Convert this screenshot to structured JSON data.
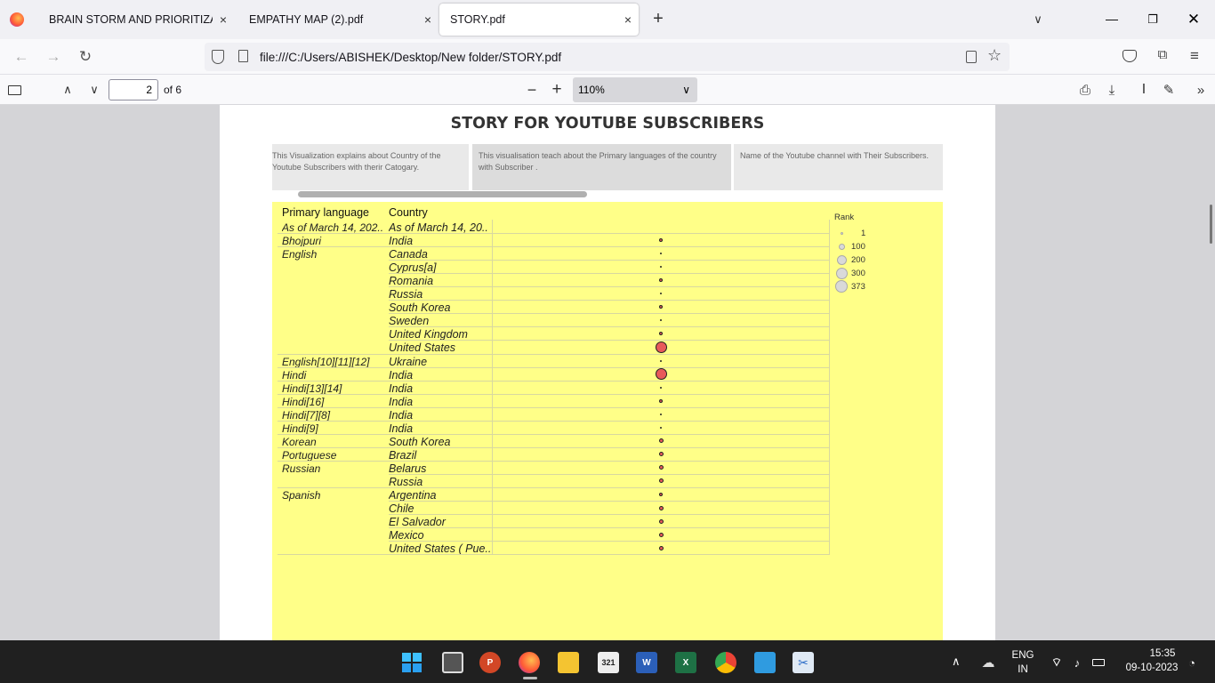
{
  "browser": {
    "tabs": [
      {
        "title": "BRAIN STORM AND PRIORITIZATION",
        "close": "×"
      },
      {
        "title": "EMPATHY MAP (2).pdf",
        "close": "×"
      },
      {
        "title": "STORY.pdf",
        "close": "×"
      }
    ],
    "url": "file:///C:/Users/ABISHEK/Desktop/New folder/STORY.pdf"
  },
  "pdf_toolbar": {
    "page_number": "2",
    "page_total": "of 6",
    "zoom": "110%"
  },
  "document": {
    "title": "STORY FOR YOUTUBE SUBSCRIBERS",
    "story_points": [
      {
        "text": "This Visualization explains about Country of the Youtube Subscribers with therir Catogary."
      },
      {
        "text": "This visualisation teach about the Primary languages of the country with Subscriber ."
      },
      {
        "text": "Name of the Youtube channel with Their Subscribers."
      }
    ],
    "headers": {
      "language": "Primary language",
      "country": "Country"
    },
    "legend": {
      "title": "Rank",
      "items": [
        "1",
        "100",
        "200",
        "300",
        "373"
      ]
    },
    "rows": [
      {
        "language": "As of March 14, 202..",
        "country": "As of March 14, 20..",
        "dot": "none"
      },
      {
        "language": "Bhojpuri",
        "country": "India",
        "dot": "s"
      },
      {
        "language": "English",
        "country": "Canada",
        "dot": "xs"
      },
      {
        "language": "",
        "country": "Cyprus[a]",
        "dot": "xs"
      },
      {
        "language": "",
        "country": "Romania",
        "dot": "s"
      },
      {
        "language": "",
        "country": "Russia",
        "dot": "xs"
      },
      {
        "language": "",
        "country": "South Korea",
        "dot": "s"
      },
      {
        "language": "",
        "country": "Sweden",
        "dot": "xs"
      },
      {
        "language": "",
        "country": "United Kingdom",
        "dot": "s"
      },
      {
        "language": "",
        "country": "United States",
        "dot": "l"
      },
      {
        "language": "English[10][11][12]",
        "country": "Ukraine",
        "dot": "xs"
      },
      {
        "language": "Hindi",
        "country": "India",
        "dot": "l"
      },
      {
        "language": "Hindi[13][14]",
        "country": "India",
        "dot": "xs"
      },
      {
        "language": "Hindi[16]",
        "country": "India",
        "dot": "s"
      },
      {
        "language": "Hindi[7][8]",
        "country": "India",
        "dot": "xs"
      },
      {
        "language": "Hindi[9]",
        "country": "India",
        "dot": "xs"
      },
      {
        "language": "Korean",
        "country": "South Korea",
        "dot": "m"
      },
      {
        "language": "Portuguese",
        "country": "Brazil",
        "dot": "m"
      },
      {
        "language": "Russian",
        "country": "Belarus",
        "dot": "m"
      },
      {
        "language": "",
        "country": "Russia",
        "dot": "m"
      },
      {
        "language": "Spanish",
        "country": "Argentina",
        "dot": "s"
      },
      {
        "language": "",
        "country": "Chile",
        "dot": "m"
      },
      {
        "language": "",
        "country": "El Salvador",
        "dot": "m"
      },
      {
        "language": "",
        "country": "Mexico",
        "dot": "m"
      },
      {
        "language": "",
        "country": "United States ( Pue..",
        "dot": "m"
      }
    ]
  },
  "taskbar": {
    "apps": [
      "start-icon",
      "task-view-icon",
      "powerpoint-icon",
      "firefox-icon",
      "file-explorer-icon",
      "calendar-icon",
      "word-icon",
      "excel-icon",
      "chrome-icon",
      "notepad-icon",
      "snipping-icon"
    ],
    "language": "ENG",
    "region": "IN",
    "time": "15:35",
    "date": "09-10-2023"
  }
}
